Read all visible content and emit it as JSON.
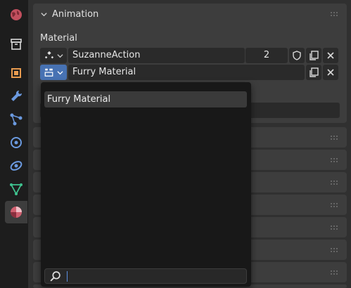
{
  "panel": {
    "title": "Animation"
  },
  "material_section": {
    "label": "Material"
  },
  "action_row": {
    "name": "SuzanneAction",
    "users": "2"
  },
  "material_row": {
    "name": "Furry Material"
  },
  "dropdown": {
    "items": [
      {
        "label": "Furry Material"
      }
    ],
    "search_value": ""
  },
  "tabs": [
    {
      "icon": "world-icon"
    },
    {
      "icon": "collection-icon"
    },
    {
      "icon": "object-icon"
    },
    {
      "icon": "modifier-wrench-icon"
    },
    {
      "icon": "particles-icon"
    },
    {
      "icon": "physics-icon"
    },
    {
      "icon": "constraints-icon"
    },
    {
      "icon": "object-data-mesh-icon"
    },
    {
      "icon": "material-icon",
      "active": true
    }
  ],
  "colors": {
    "accent": "#4772b3",
    "panel_bg": "#3d3d3d",
    "field_bg": "#2a2a2a",
    "dropdown_bg": "#181818"
  }
}
